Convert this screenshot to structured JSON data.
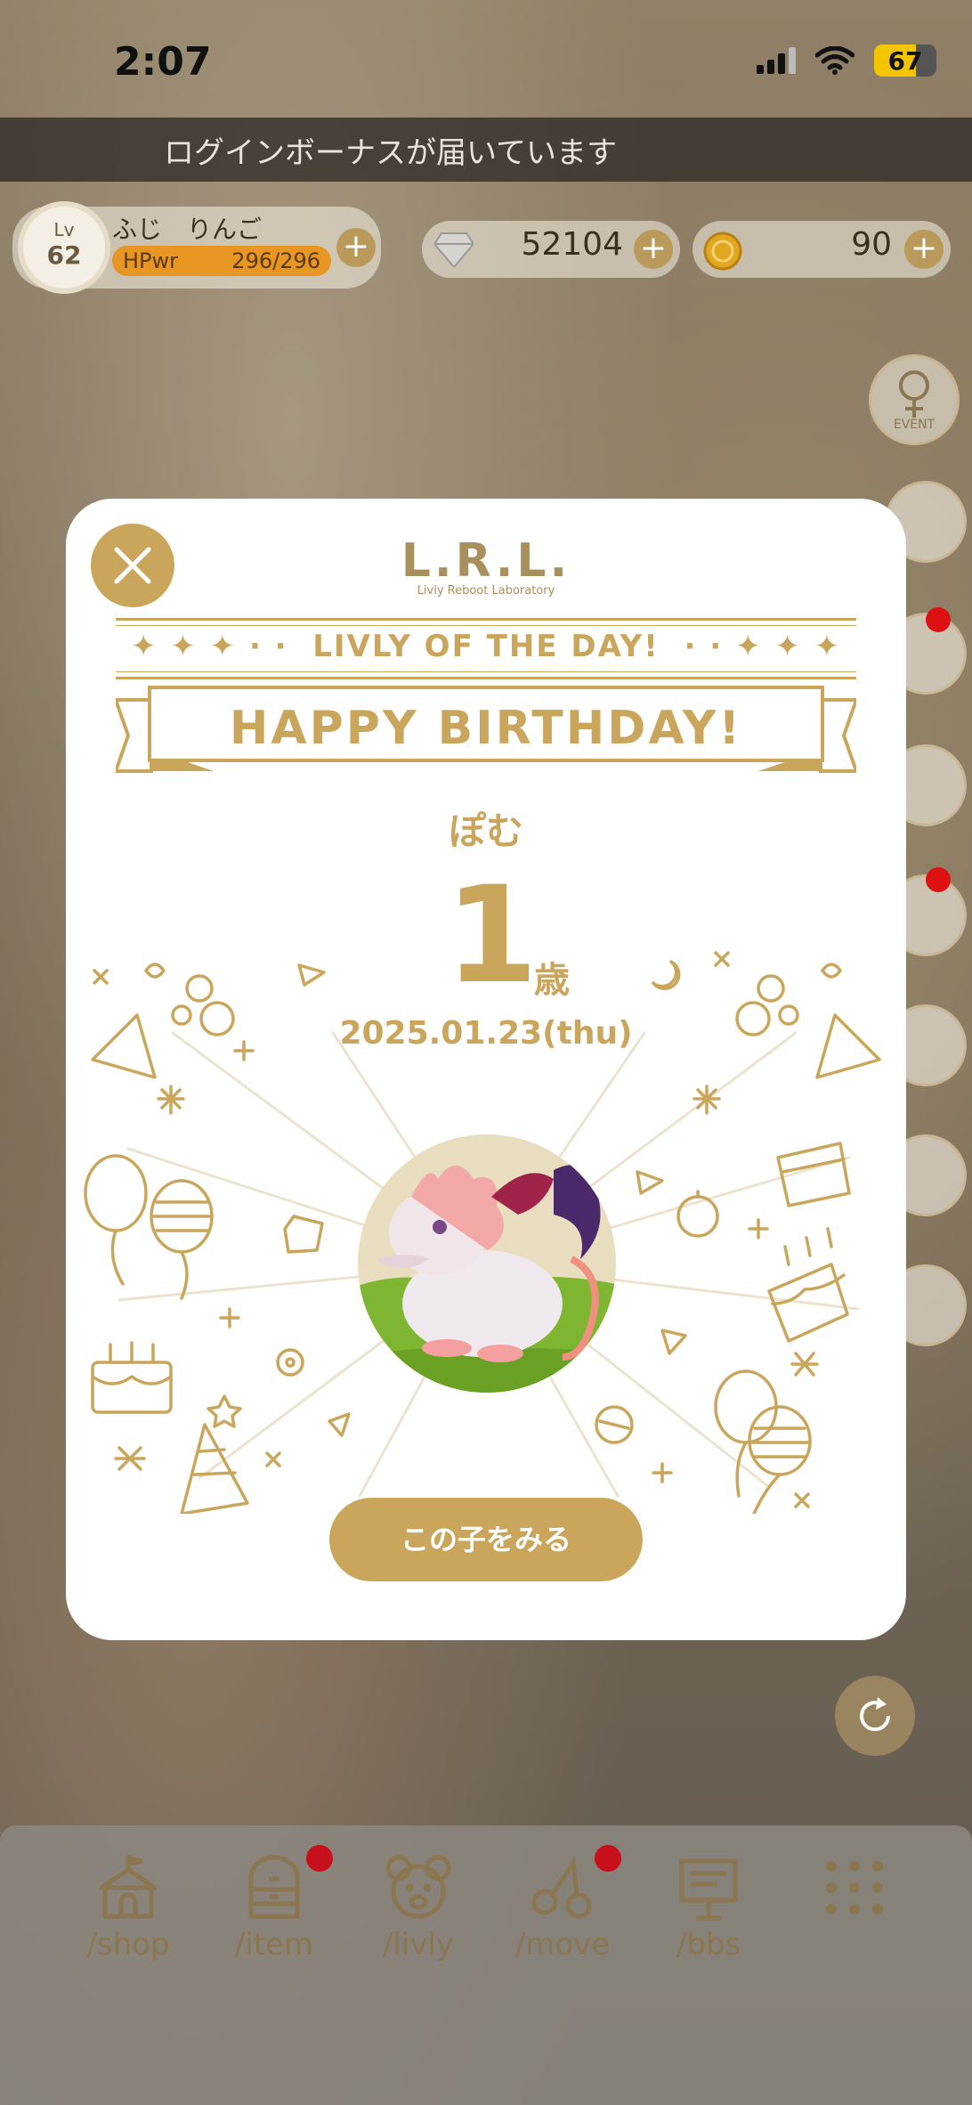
{
  "status_bar": {
    "time": "2:07",
    "battery": "67"
  },
  "banner": {
    "text": "ログインボーナスが届いています"
  },
  "player": {
    "level_label": "Lv",
    "level": "62",
    "name": "ふじ　りんご",
    "hp_label": "HPwr",
    "hp_value": "296/296",
    "hp_fraction": 1.0
  },
  "currency": {
    "gems": "52104",
    "coins": "90"
  },
  "side_buttons": {
    "event_label": "EVENT"
  },
  "modal": {
    "logo_main": "L.R.L.",
    "logo_sub": "Livly Reboot Laboratory",
    "subtitle": "LIVLY OF THE DAY!",
    "headline": "HAPPY BIRTHDAY!",
    "pet_name": "ぽむ",
    "age": "1",
    "age_unit": "歳",
    "birthday": "2025.01.23(thu)",
    "cta_label": "この子をみる"
  },
  "nav": {
    "items": [
      {
        "label": "/shop",
        "icon": "tent-icon"
      },
      {
        "label": "/item",
        "icon": "drawer-icon"
      },
      {
        "label": "/livly",
        "icon": "bear-face-icon"
      },
      {
        "label": "/move",
        "icon": "move-icon"
      },
      {
        "label": "/bbs",
        "icon": "board-icon"
      },
      {
        "label": "",
        "icon": "grid-menu-icon"
      }
    ]
  },
  "colors": {
    "gold": "#c9a65c",
    "hp_orange": "#e79623",
    "badge_red": "#c8101c"
  }
}
